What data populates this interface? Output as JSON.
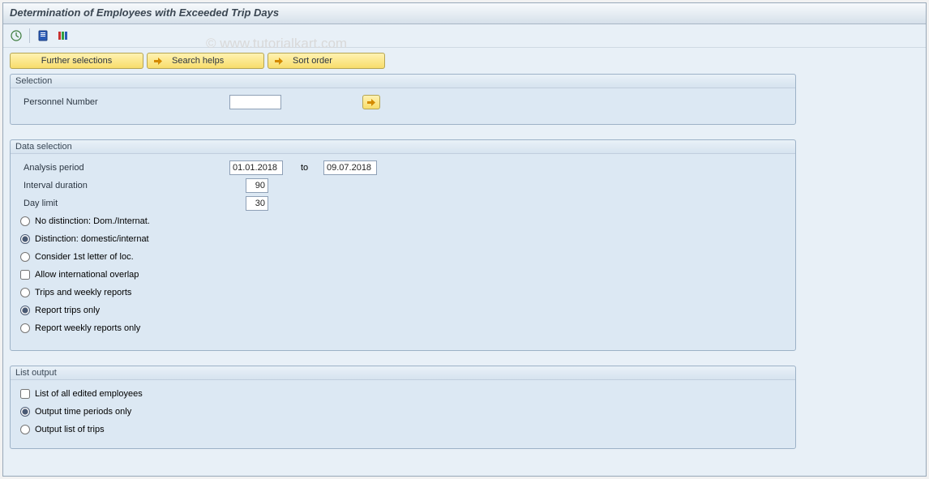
{
  "header": {
    "title": "Determination of Employees with Exceeded Trip Days",
    "watermark": "© www.tutorialkart.com"
  },
  "toolbar": {
    "execute_icon": "execute-icon",
    "info_icon": "program-doc-icon",
    "variants_icon": "variants-icon"
  },
  "selection_buttons": {
    "further": "Further selections",
    "search_helps": "Search helps",
    "sort_order": "Sort order"
  },
  "selection_box": {
    "title": "Selection",
    "personnel_number_label": "Personnel Number",
    "personnel_number_value": ""
  },
  "data_selection_box": {
    "title": "Data selection",
    "analysis_period_label": "Analysis period",
    "period_from": "01.01.2018",
    "to_label": "to",
    "period_to": "09.07.2018",
    "interval_duration_label": "Interval duration",
    "interval_duration_value": "90",
    "day_limit_label": "Day limit",
    "day_limit_value": "30",
    "r_no_distinction": "No distinction: Dom./Internat.",
    "r_distinction": "Distinction: domestic/internat",
    "r_first_letter": "Consider 1st letter of loc.",
    "c_allow_overlap": "Allow international overlap",
    "r_trips_and_weekly": "Trips and weekly reports",
    "r_trips_only": "Report trips only",
    "r_weekly_only": "Report weekly reports only"
  },
  "list_output_box": {
    "title": "List output",
    "c_all_employees": "List of all edited employees",
    "r_time_periods": "Output time periods only",
    "r_list_of_trips": "Output list of trips"
  }
}
